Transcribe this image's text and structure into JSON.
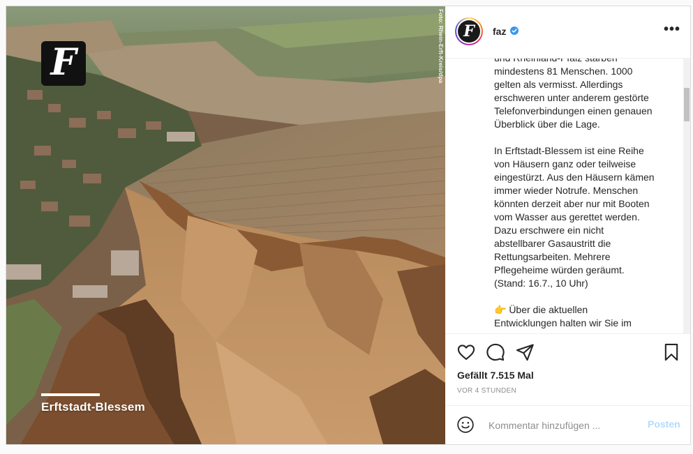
{
  "photo": {
    "logo_letter": "F",
    "location_caption": "Erftstadt-Blessem",
    "photo_credit": "Foto: Rhein-Erft-Kreis/dpa"
  },
  "header": {
    "avatar_letter": "F",
    "username": "faz",
    "verified": true,
    "more_label": "•••"
  },
  "caption": {
    "paragraphs": [
      "und Rheinland-Pfalz starben\nmindestens 81 Menschen. 1000\ngelten als vermisst. Allerdings\nerschweren unter anderem gestörte\nTelefonverbindungen einen genauen\nÜberblick über die Lage.",
      "In Erftstadt-Blessem ist eine Reihe\nvon Häusern ganz oder teilweise\neingestürzt. Aus den Häusern kämen\nimmer wieder Notrufe. Menschen\nkönnten derzeit aber nur mit Booten\nvom Wasser aus gerettet werden.\nDazu erschwere ein nicht\nabstellbarer Gasaustritt die\nRettungsarbeiten. Mehrere\nPflegeheime würden geräumt.\n(Stand: 16.7., 10 Uhr)",
      "👉 Über die aktuellen\nEntwicklungen halten wir Sie im"
    ]
  },
  "actions": {
    "icons": [
      "heart-icon",
      "comment-icon",
      "share-icon",
      "bookmark-icon"
    ],
    "likes_text": "Gefällt 7.515 Mal",
    "time_ago": "VOR 4 STUNDEN"
  },
  "comment": {
    "placeholder": "Kommentar hinzufügen ...",
    "post_label": "Posten",
    "emoji_icon": "smiley-icon"
  },
  "colors": {
    "verified_blue": "#3897f0",
    "post_button_disabled": "#b3dbff",
    "muted_text": "#8e8e8e"
  }
}
